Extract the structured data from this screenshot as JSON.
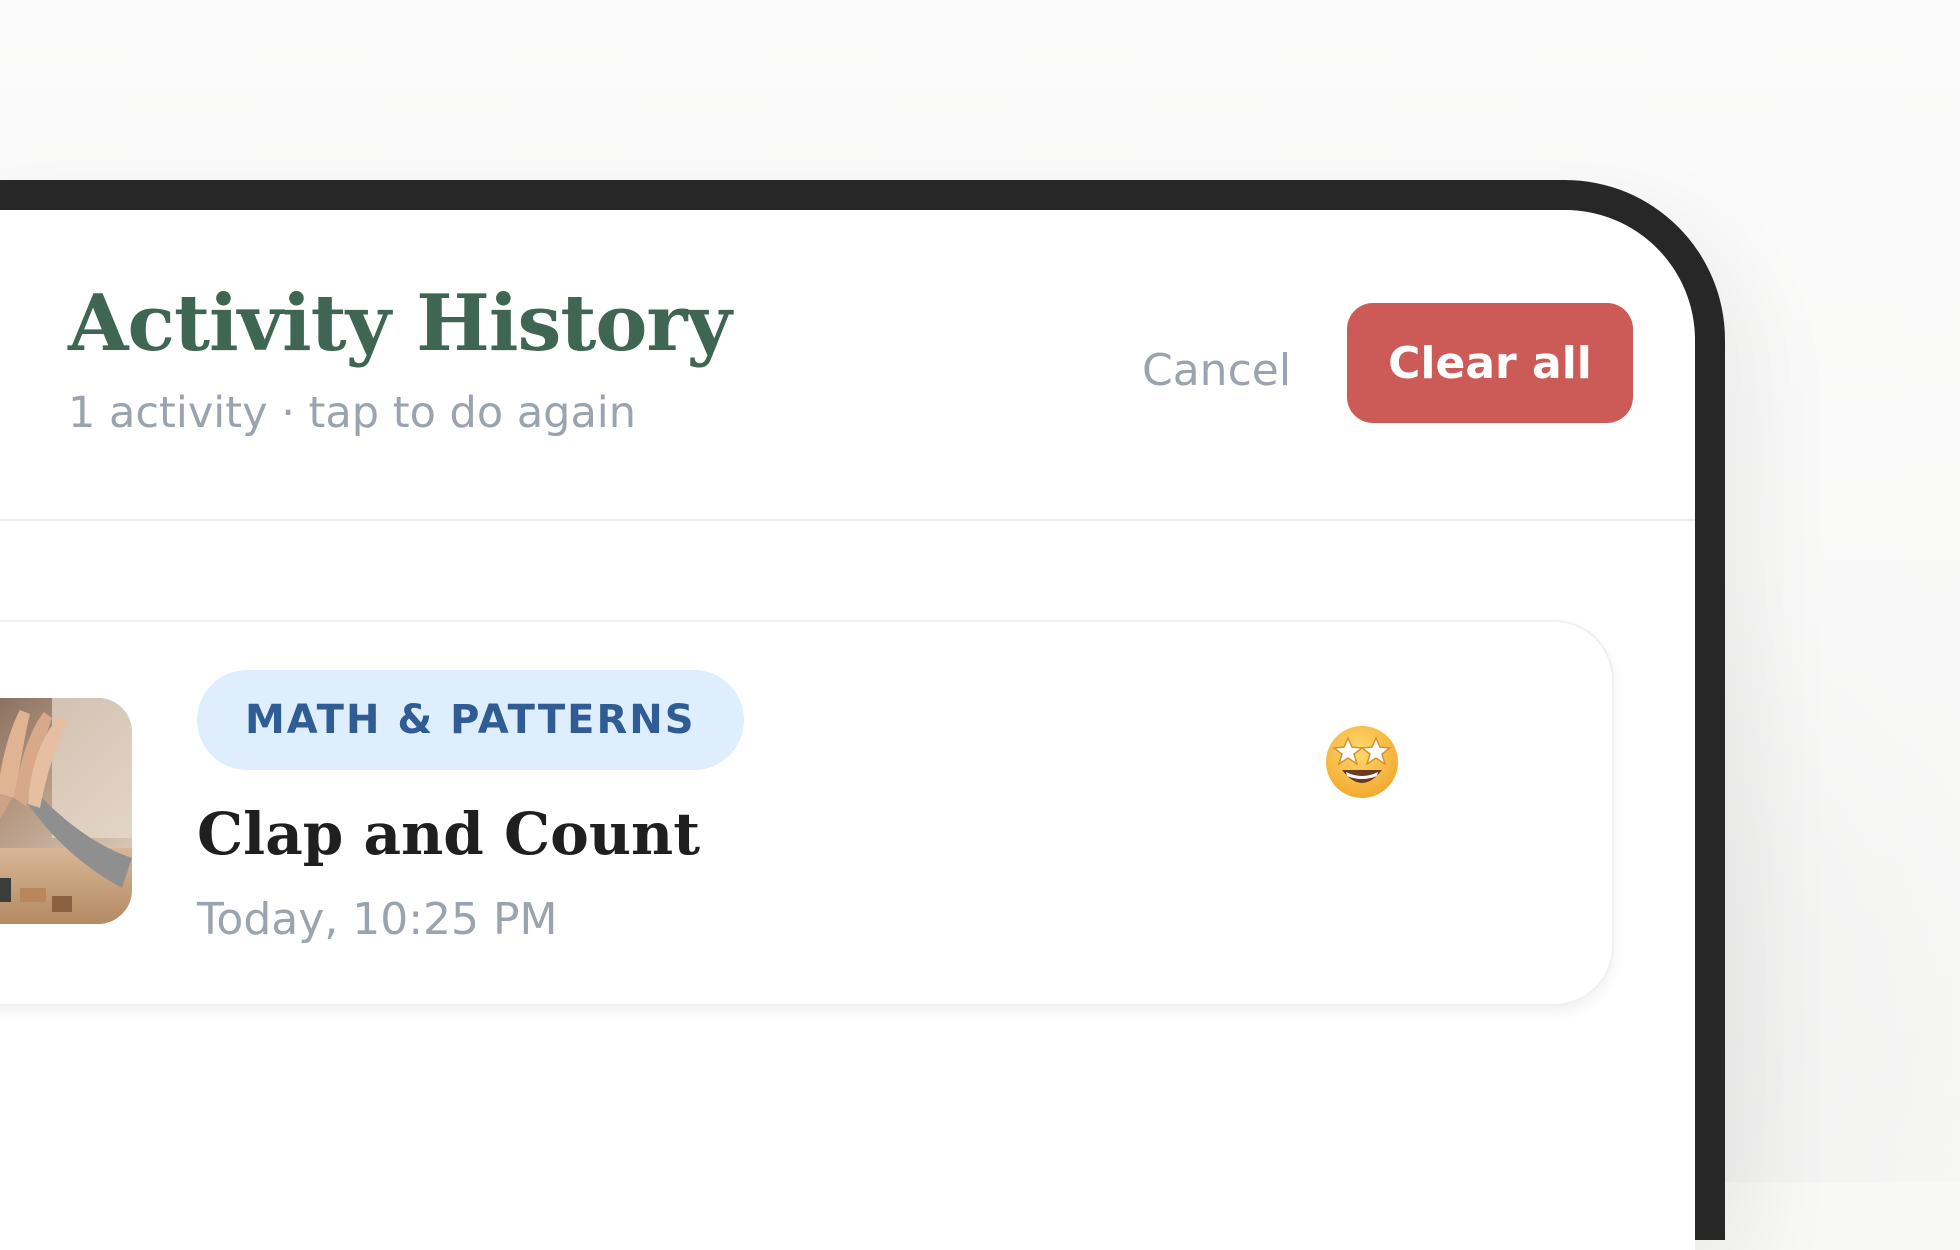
{
  "header": {
    "title": "Activity History",
    "subtitle": "1 activity · tap to do again",
    "cancel_label": "Cancel",
    "clear_all_label": "Clear all"
  },
  "activities": [
    {
      "category": "MATH & PATTERNS",
      "title": "Clap and Count",
      "time": "Today, 10:25 PM",
      "thumbnail": "hands-high-five-photo",
      "mood_icon": "star-struck-emoji-icon"
    }
  ],
  "colors": {
    "title": "#3f6553",
    "muted_text": "#9ba3ae",
    "clear_all_button": "#cc5b57",
    "badge_background": "#dfeefc",
    "badge_text": "#2f5c94",
    "device_frame": "#262726"
  }
}
